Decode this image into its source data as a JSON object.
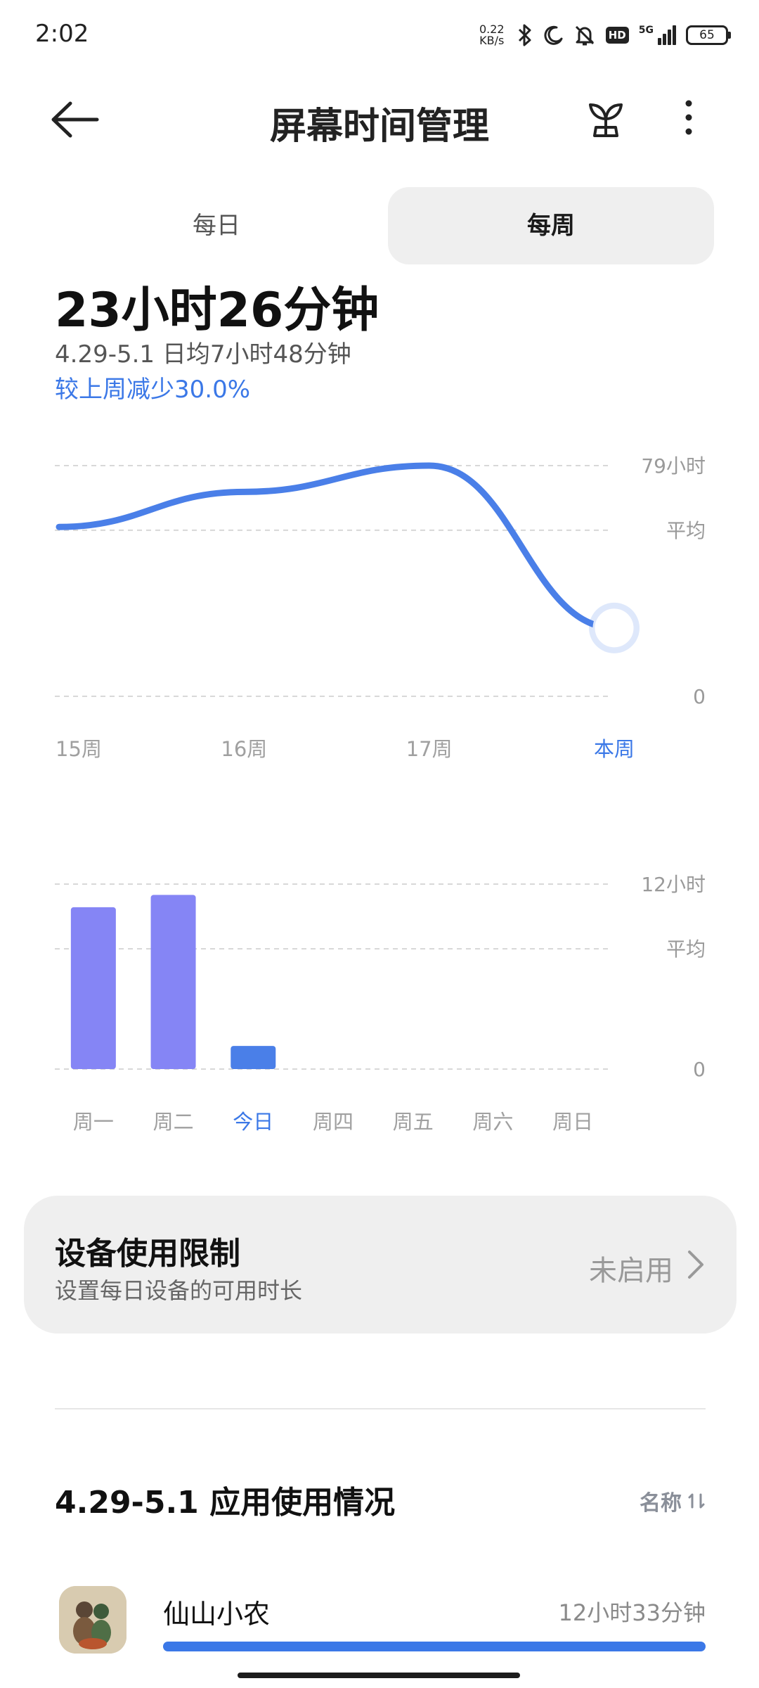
{
  "status_bar": {
    "time": "2:02",
    "net_speed_value": "0.22",
    "net_speed_unit": "KB/s",
    "hd_label": "HD",
    "signal_label": "5G",
    "battery": "65"
  },
  "header": {
    "title": "屏幕时间管理"
  },
  "tabs": {
    "daily": "每日",
    "weekly": "每周",
    "selected": "每周"
  },
  "summary": {
    "total": "23小时26分钟",
    "average": "4.29-5.1 日均7小时48分钟",
    "comparison": "较上周减少30.0%"
  },
  "chart_data": [
    {
      "type": "line",
      "categories": [
        "15周",
        "16周",
        "17周",
        "本周"
      ],
      "values": [
        58,
        70,
        79,
        23.4
      ],
      "y_axis_labels": [
        "79小时",
        "平均",
        "0"
      ],
      "ylim": [
        0,
        79
      ],
      "highlight_index": 3,
      "color": "#4a7fe8"
    },
    {
      "type": "bar",
      "categories": [
        "周一",
        "周二",
        "今日",
        "周四",
        "周五",
        "周六",
        "周日"
      ],
      "values": [
        10.5,
        11.3,
        1.5,
        null,
        null,
        null,
        null
      ],
      "y_axis_labels": [
        "12小时",
        "平均",
        "0"
      ],
      "ylim": [
        0,
        12
      ],
      "highlight_index": 2,
      "bar_color": "#8585f5",
      "highlight_color": "#4a7fe8"
    }
  ],
  "device_limit": {
    "title": "设备使用限制",
    "description": "设置每日设备的可用时长",
    "status": "未启用"
  },
  "app_usage": {
    "title": "4.29-5.1 应用使用情况",
    "sort_label": "名称",
    "apps": [
      {
        "name": "仙山小农",
        "time": "12小时33分钟",
        "fraction": 1.0
      }
    ]
  }
}
